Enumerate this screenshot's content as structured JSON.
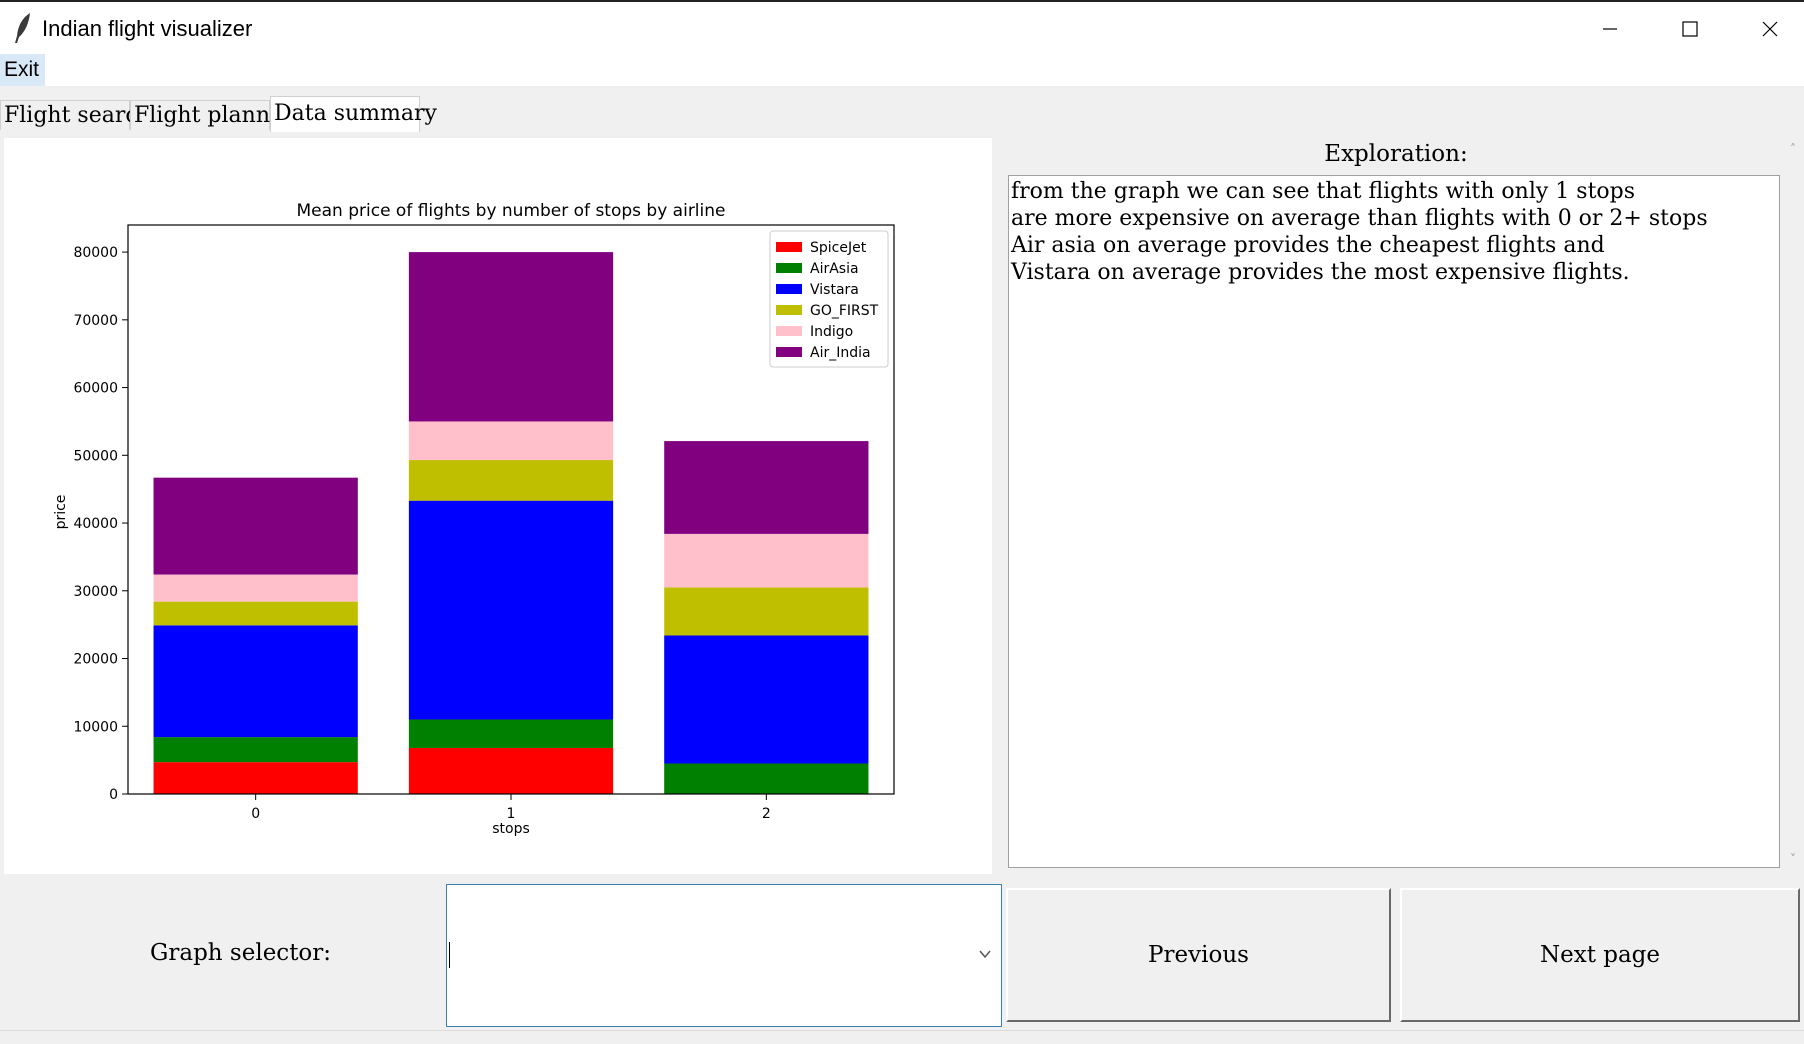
{
  "window": {
    "title": "Indian flight visualizer"
  },
  "menu": {
    "exit_label": "Exit"
  },
  "tabs": [
    {
      "label": "Flight search"
    },
    {
      "label": "Flight planner"
    },
    {
      "label": "Data summary"
    }
  ],
  "exploration": {
    "label": "Exploration:",
    "lines": [
      "from the graph we can see that flights with only 1 stops",
      "are more expensive on average than flights with 0 or 2+ stops",
      "Air asia on average provides the cheapest flights and",
      "Vistara on average provides the most expensive flights."
    ]
  },
  "controls": {
    "graph_selector_label": "Graph selector:",
    "graph_selector_value": "",
    "previous_label": "Previous",
    "next_label": "Next page"
  },
  "chart_data": {
    "type": "bar",
    "stacked": true,
    "title": "Mean price of flights by number of stops by airline",
    "xlabel": "stops",
    "ylabel": "price",
    "categories": [
      "0",
      "1",
      "2"
    ],
    "ylim": [
      0,
      84000
    ],
    "yticks": [
      0,
      10000,
      20000,
      30000,
      40000,
      50000,
      60000,
      70000,
      80000
    ],
    "legend_position": "top-right",
    "series": [
      {
        "name": "SpiceJet",
        "color": "#ff0000",
        "values": [
          4700,
          6800,
          0
        ]
      },
      {
        "name": "AirAsia",
        "color": "#008000",
        "values": [
          3700,
          4200,
          4500
        ]
      },
      {
        "name": "Vistara",
        "color": "#0000ff",
        "values": [
          16500,
          32300,
          18900
        ]
      },
      {
        "name": "GO_FIRST",
        "color": "#bfbf00",
        "values": [
          3500,
          6000,
          7100
        ]
      },
      {
        "name": "Indigo",
        "color": "#ffc0cb",
        "values": [
          4000,
          5700,
          7900
        ]
      },
      {
        "name": "Air_India",
        "color": "#800080",
        "values": [
          14300,
          25000,
          13700
        ]
      }
    ]
  }
}
